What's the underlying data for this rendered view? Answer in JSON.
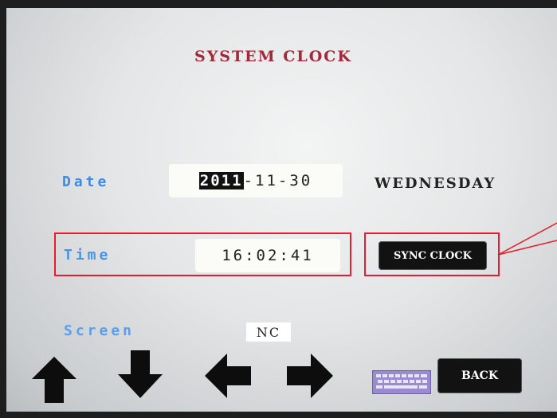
{
  "title": "SYSTEM CLOCK",
  "date": {
    "label": "Date",
    "year": "2011",
    "rest": "-11-30",
    "weekday": "WEDNESDAY"
  },
  "time": {
    "label": "Time",
    "value": "16:02:41"
  },
  "screen": {
    "label": "Screen",
    "value": "NC"
  },
  "buttons": {
    "sync_clock": "SYNC CLOCK",
    "back": "BACK"
  },
  "icons": {
    "up": "arrow-up-icon",
    "down": "arrow-down-icon",
    "left": "arrow-left-icon",
    "right": "arrow-right-icon",
    "keyboard": "keyboard-icon"
  },
  "colors": {
    "title": "#a3283a",
    "label": "#3b8be6",
    "highlight": "#e0212b",
    "button": "#121212"
  }
}
